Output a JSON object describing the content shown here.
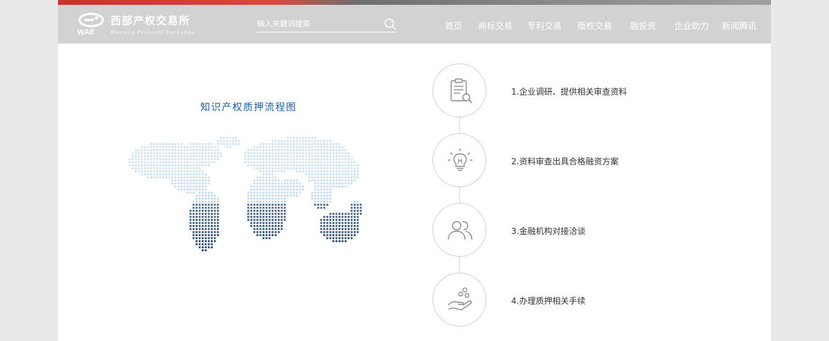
{
  "brand": {
    "name_cn": "西部产权交易所",
    "name_en": "Western Property Exchange",
    "abbr": "WAE",
    "mark_icon": "wae-logo-icon"
  },
  "search": {
    "placeholder": "输入关键词搜索",
    "icon": "search-icon"
  },
  "nav": {
    "items": [
      {
        "label": "首页"
      },
      {
        "label": "商标交易"
      },
      {
        "label": "专利交易"
      },
      {
        "label": "版权交易"
      },
      {
        "label": "融投资"
      },
      {
        "label": "企业助力"
      },
      {
        "label": "新闻腾讯"
      }
    ]
  },
  "main": {
    "title": "知识产权质押流程图",
    "map_icon": "world-map-dots-icon",
    "steps": [
      {
        "label": "1.企业调研、提供相关审查资料",
        "icon": "clipboard-search-icon"
      },
      {
        "label": "2.资料审查出具合格融资方案",
        "icon": "lightbulb-icon"
      },
      {
        "label": "3.金融机构对接洽谈",
        "icon": "users-icon"
      },
      {
        "label": "4.办理质押相关手续",
        "icon": "hand-coins-icon"
      }
    ]
  },
  "colors": {
    "header_bg": "#d2d2d2",
    "accent_red": "#c83228",
    "title_blue": "#1f5fa8",
    "map_light": "#a9cbe6",
    "map_dark": "#1b3d64"
  }
}
